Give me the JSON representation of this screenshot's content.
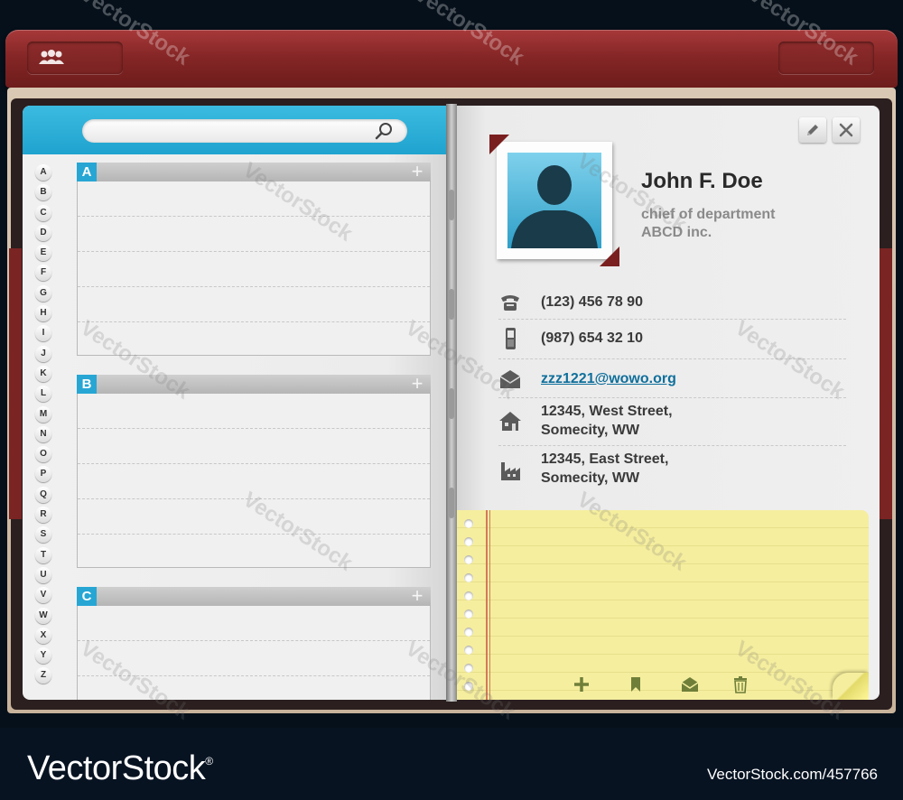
{
  "header": {
    "left_button_icon": "people-icon",
    "right_button_icon": ""
  },
  "search": {
    "value": "",
    "placeholder": "",
    "icon": "magnifier-icon"
  },
  "alphabet": [
    "A",
    "B",
    "C",
    "D",
    "E",
    "F",
    "G",
    "H",
    "I",
    "J",
    "K",
    "L",
    "M",
    "N",
    "O",
    "P",
    "Q",
    "R",
    "S",
    "T",
    "U",
    "V",
    "W",
    "X",
    "Y",
    "Z"
  ],
  "sections": [
    {
      "letter": "A",
      "add_icon": "plus-icon"
    },
    {
      "letter": "B",
      "add_icon": "plus-icon"
    },
    {
      "letter": "C",
      "add_icon": "plus-icon"
    }
  ],
  "contact": {
    "name": "John F. Doe",
    "title": "chief of department",
    "company": "ABCD inc.",
    "phone": "(123) 456 78 90",
    "mobile": "(987) 654 32 10",
    "email": "zzz1221@wowo.org",
    "home_address_line1": "12345, West Street,",
    "home_address_line2": "Somecity, WW",
    "work_address_line1": "12345, East Street,",
    "work_address_line2": "Somecity, WW"
  },
  "toolbar": {
    "edit_icon": "pencil-icon",
    "close_icon": "close-icon"
  },
  "note_tools": [
    "plus-icon",
    "bookmark-icon",
    "mail-icon",
    "trash-icon"
  ],
  "watermark": "VectorStock",
  "footer": {
    "brand": "VectorStock",
    "registered": "®",
    "asset_id": "VectorStock.com/457766"
  },
  "colors": {
    "accent_blue": "#27a6d4",
    "leather_red": "#862626",
    "note_yellow": "#f5ee9e",
    "link": "#0f6f9b"
  }
}
